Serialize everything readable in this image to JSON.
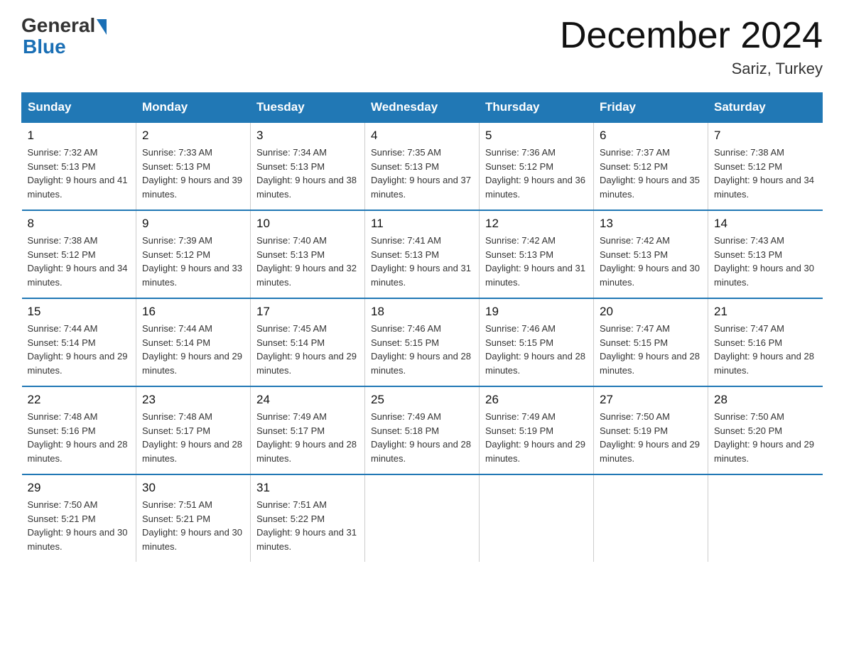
{
  "header": {
    "logo_general": "General",
    "logo_blue": "Blue",
    "month_title": "December 2024",
    "location": "Sariz, Turkey"
  },
  "weekdays": [
    "Sunday",
    "Monday",
    "Tuesday",
    "Wednesday",
    "Thursday",
    "Friday",
    "Saturday"
  ],
  "weeks": [
    [
      {
        "day": "1",
        "sunrise": "7:32 AM",
        "sunset": "5:13 PM",
        "daylight": "9 hours and 41 minutes."
      },
      {
        "day": "2",
        "sunrise": "7:33 AM",
        "sunset": "5:13 PM",
        "daylight": "9 hours and 39 minutes."
      },
      {
        "day": "3",
        "sunrise": "7:34 AM",
        "sunset": "5:13 PM",
        "daylight": "9 hours and 38 minutes."
      },
      {
        "day": "4",
        "sunrise": "7:35 AM",
        "sunset": "5:13 PM",
        "daylight": "9 hours and 37 minutes."
      },
      {
        "day": "5",
        "sunrise": "7:36 AM",
        "sunset": "5:12 PM",
        "daylight": "9 hours and 36 minutes."
      },
      {
        "day": "6",
        "sunrise": "7:37 AM",
        "sunset": "5:12 PM",
        "daylight": "9 hours and 35 minutes."
      },
      {
        "day": "7",
        "sunrise": "7:38 AM",
        "sunset": "5:12 PM",
        "daylight": "9 hours and 34 minutes."
      }
    ],
    [
      {
        "day": "8",
        "sunrise": "7:38 AM",
        "sunset": "5:12 PM",
        "daylight": "9 hours and 34 minutes."
      },
      {
        "day": "9",
        "sunrise": "7:39 AM",
        "sunset": "5:12 PM",
        "daylight": "9 hours and 33 minutes."
      },
      {
        "day": "10",
        "sunrise": "7:40 AM",
        "sunset": "5:13 PM",
        "daylight": "9 hours and 32 minutes."
      },
      {
        "day": "11",
        "sunrise": "7:41 AM",
        "sunset": "5:13 PM",
        "daylight": "9 hours and 31 minutes."
      },
      {
        "day": "12",
        "sunrise": "7:42 AM",
        "sunset": "5:13 PM",
        "daylight": "9 hours and 31 minutes."
      },
      {
        "day": "13",
        "sunrise": "7:42 AM",
        "sunset": "5:13 PM",
        "daylight": "9 hours and 30 minutes."
      },
      {
        "day": "14",
        "sunrise": "7:43 AM",
        "sunset": "5:13 PM",
        "daylight": "9 hours and 30 minutes."
      }
    ],
    [
      {
        "day": "15",
        "sunrise": "7:44 AM",
        "sunset": "5:14 PM",
        "daylight": "9 hours and 29 minutes."
      },
      {
        "day": "16",
        "sunrise": "7:44 AM",
        "sunset": "5:14 PM",
        "daylight": "9 hours and 29 minutes."
      },
      {
        "day": "17",
        "sunrise": "7:45 AM",
        "sunset": "5:14 PM",
        "daylight": "9 hours and 29 minutes."
      },
      {
        "day": "18",
        "sunrise": "7:46 AM",
        "sunset": "5:15 PM",
        "daylight": "9 hours and 28 minutes."
      },
      {
        "day": "19",
        "sunrise": "7:46 AM",
        "sunset": "5:15 PM",
        "daylight": "9 hours and 28 minutes."
      },
      {
        "day": "20",
        "sunrise": "7:47 AM",
        "sunset": "5:15 PM",
        "daylight": "9 hours and 28 minutes."
      },
      {
        "day": "21",
        "sunrise": "7:47 AM",
        "sunset": "5:16 PM",
        "daylight": "9 hours and 28 minutes."
      }
    ],
    [
      {
        "day": "22",
        "sunrise": "7:48 AM",
        "sunset": "5:16 PM",
        "daylight": "9 hours and 28 minutes."
      },
      {
        "day": "23",
        "sunrise": "7:48 AM",
        "sunset": "5:17 PM",
        "daylight": "9 hours and 28 minutes."
      },
      {
        "day": "24",
        "sunrise": "7:49 AM",
        "sunset": "5:17 PM",
        "daylight": "9 hours and 28 minutes."
      },
      {
        "day": "25",
        "sunrise": "7:49 AM",
        "sunset": "5:18 PM",
        "daylight": "9 hours and 28 minutes."
      },
      {
        "day": "26",
        "sunrise": "7:49 AM",
        "sunset": "5:19 PM",
        "daylight": "9 hours and 29 minutes."
      },
      {
        "day": "27",
        "sunrise": "7:50 AM",
        "sunset": "5:19 PM",
        "daylight": "9 hours and 29 minutes."
      },
      {
        "day": "28",
        "sunrise": "7:50 AM",
        "sunset": "5:20 PM",
        "daylight": "9 hours and 29 minutes."
      }
    ],
    [
      {
        "day": "29",
        "sunrise": "7:50 AM",
        "sunset": "5:21 PM",
        "daylight": "9 hours and 30 minutes."
      },
      {
        "day": "30",
        "sunrise": "7:51 AM",
        "sunset": "5:21 PM",
        "daylight": "9 hours and 30 minutes."
      },
      {
        "day": "31",
        "sunrise": "7:51 AM",
        "sunset": "5:22 PM",
        "daylight": "9 hours and 31 minutes."
      },
      null,
      null,
      null,
      null
    ]
  ],
  "labels": {
    "sunrise_prefix": "Sunrise: ",
    "sunset_prefix": "Sunset: ",
    "daylight_prefix": "Daylight: "
  }
}
